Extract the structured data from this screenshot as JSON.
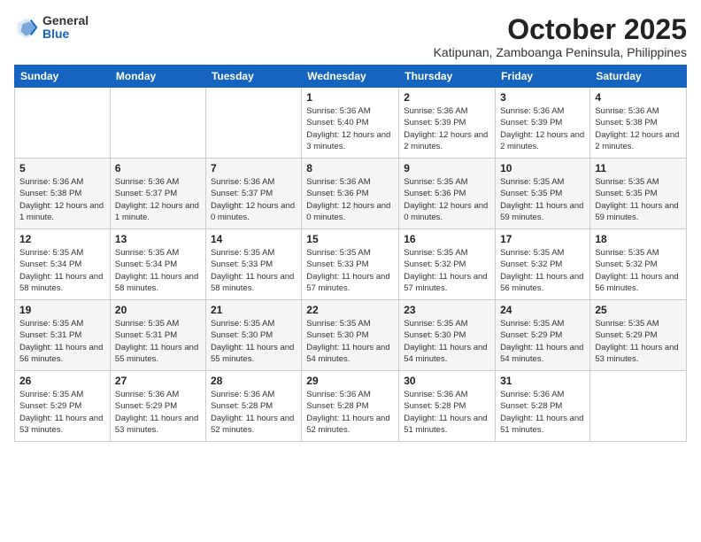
{
  "logo": {
    "general": "General",
    "blue": "Blue"
  },
  "header": {
    "month": "October 2025",
    "subtitle": "Katipunan, Zamboanga Peninsula, Philippines"
  },
  "days_of_week": [
    "Sunday",
    "Monday",
    "Tuesday",
    "Wednesday",
    "Thursday",
    "Friday",
    "Saturday"
  ],
  "weeks": [
    [
      {
        "day": "",
        "info": ""
      },
      {
        "day": "",
        "info": ""
      },
      {
        "day": "",
        "info": ""
      },
      {
        "day": "1",
        "info": "Sunrise: 5:36 AM\nSunset: 5:40 PM\nDaylight: 12 hours and 3 minutes."
      },
      {
        "day": "2",
        "info": "Sunrise: 5:36 AM\nSunset: 5:39 PM\nDaylight: 12 hours and 2 minutes."
      },
      {
        "day": "3",
        "info": "Sunrise: 5:36 AM\nSunset: 5:39 PM\nDaylight: 12 hours and 2 minutes."
      },
      {
        "day": "4",
        "info": "Sunrise: 5:36 AM\nSunset: 5:38 PM\nDaylight: 12 hours and 2 minutes."
      }
    ],
    [
      {
        "day": "5",
        "info": "Sunrise: 5:36 AM\nSunset: 5:38 PM\nDaylight: 12 hours and 1 minute."
      },
      {
        "day": "6",
        "info": "Sunrise: 5:36 AM\nSunset: 5:37 PM\nDaylight: 12 hours and 1 minute."
      },
      {
        "day": "7",
        "info": "Sunrise: 5:36 AM\nSunset: 5:37 PM\nDaylight: 12 hours and 0 minutes."
      },
      {
        "day": "8",
        "info": "Sunrise: 5:36 AM\nSunset: 5:36 PM\nDaylight: 12 hours and 0 minutes."
      },
      {
        "day": "9",
        "info": "Sunrise: 5:35 AM\nSunset: 5:36 PM\nDaylight: 12 hours and 0 minutes."
      },
      {
        "day": "10",
        "info": "Sunrise: 5:35 AM\nSunset: 5:35 PM\nDaylight: 11 hours and 59 minutes."
      },
      {
        "day": "11",
        "info": "Sunrise: 5:35 AM\nSunset: 5:35 PM\nDaylight: 11 hours and 59 minutes."
      }
    ],
    [
      {
        "day": "12",
        "info": "Sunrise: 5:35 AM\nSunset: 5:34 PM\nDaylight: 11 hours and 58 minutes."
      },
      {
        "day": "13",
        "info": "Sunrise: 5:35 AM\nSunset: 5:34 PM\nDaylight: 11 hours and 58 minutes."
      },
      {
        "day": "14",
        "info": "Sunrise: 5:35 AM\nSunset: 5:33 PM\nDaylight: 11 hours and 58 minutes."
      },
      {
        "day": "15",
        "info": "Sunrise: 5:35 AM\nSunset: 5:33 PM\nDaylight: 11 hours and 57 minutes."
      },
      {
        "day": "16",
        "info": "Sunrise: 5:35 AM\nSunset: 5:32 PM\nDaylight: 11 hours and 57 minutes."
      },
      {
        "day": "17",
        "info": "Sunrise: 5:35 AM\nSunset: 5:32 PM\nDaylight: 11 hours and 56 minutes."
      },
      {
        "day": "18",
        "info": "Sunrise: 5:35 AM\nSunset: 5:32 PM\nDaylight: 11 hours and 56 minutes."
      }
    ],
    [
      {
        "day": "19",
        "info": "Sunrise: 5:35 AM\nSunset: 5:31 PM\nDaylight: 11 hours and 56 minutes."
      },
      {
        "day": "20",
        "info": "Sunrise: 5:35 AM\nSunset: 5:31 PM\nDaylight: 11 hours and 55 minutes."
      },
      {
        "day": "21",
        "info": "Sunrise: 5:35 AM\nSunset: 5:30 PM\nDaylight: 11 hours and 55 minutes."
      },
      {
        "day": "22",
        "info": "Sunrise: 5:35 AM\nSunset: 5:30 PM\nDaylight: 11 hours and 54 minutes."
      },
      {
        "day": "23",
        "info": "Sunrise: 5:35 AM\nSunset: 5:30 PM\nDaylight: 11 hours and 54 minutes."
      },
      {
        "day": "24",
        "info": "Sunrise: 5:35 AM\nSunset: 5:29 PM\nDaylight: 11 hours and 54 minutes."
      },
      {
        "day": "25",
        "info": "Sunrise: 5:35 AM\nSunset: 5:29 PM\nDaylight: 11 hours and 53 minutes."
      }
    ],
    [
      {
        "day": "26",
        "info": "Sunrise: 5:35 AM\nSunset: 5:29 PM\nDaylight: 11 hours and 53 minutes."
      },
      {
        "day": "27",
        "info": "Sunrise: 5:36 AM\nSunset: 5:29 PM\nDaylight: 11 hours and 53 minutes."
      },
      {
        "day": "28",
        "info": "Sunrise: 5:36 AM\nSunset: 5:28 PM\nDaylight: 11 hours and 52 minutes."
      },
      {
        "day": "29",
        "info": "Sunrise: 5:36 AM\nSunset: 5:28 PM\nDaylight: 11 hours and 52 minutes."
      },
      {
        "day": "30",
        "info": "Sunrise: 5:36 AM\nSunset: 5:28 PM\nDaylight: 11 hours and 51 minutes."
      },
      {
        "day": "31",
        "info": "Sunrise: 5:36 AM\nSunset: 5:28 PM\nDaylight: 11 hours and 51 minutes."
      },
      {
        "day": "",
        "info": ""
      }
    ]
  ]
}
